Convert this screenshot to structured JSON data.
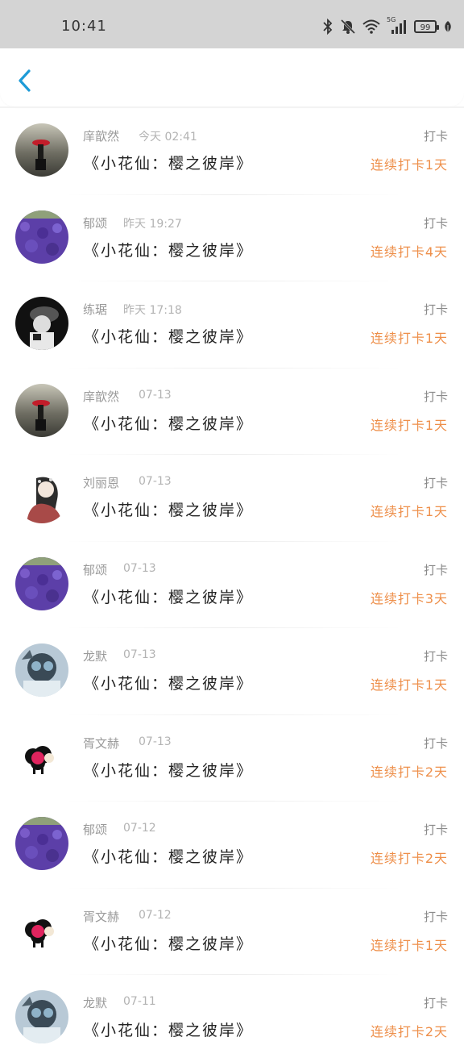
{
  "status_bar": {
    "time": "10:41",
    "battery": "99",
    "network": "5G",
    "icons": [
      "bluetooth-icon",
      "mute-bell-icon",
      "wifi-icon",
      "signal-icon",
      "battery-icon",
      "leaf-icon"
    ]
  },
  "header": {
    "back_icon": "chevron-left-icon",
    "accent_color": "#1e9bd7"
  },
  "colors": {
    "streak": "#ee8f4a",
    "name": "#9a9a9a"
  },
  "checkins": [
    {
      "name": "庠歆然",
      "time": "今天 02:41",
      "title": "《小花仙：樱之彼岸》",
      "action": "打卡",
      "streak": "连续打卡1天",
      "avatar": "red-umbrella-avatar"
    },
    {
      "name": "郁颂",
      "time": "昨天 19:27",
      "title": "《小花仙：樱之彼岸》",
      "action": "打卡",
      "streak": "连续打卡4天",
      "avatar": "lavender-field-avatar"
    },
    {
      "name": "练琚",
      "time": "昨天 17:18",
      "title": "《小花仙：樱之彼岸》",
      "action": "打卡",
      "streak": "连续打卡1天",
      "avatar": "bw-portrait-avatar"
    },
    {
      "name": "庠歆然",
      "time": "07-13",
      "title": "《小花仙：樱之彼岸》",
      "action": "打卡",
      "streak": "连续打卡1天",
      "avatar": "red-umbrella-avatar"
    },
    {
      "name": "刘丽恩",
      "time": "07-13",
      "title": "《小花仙：樱之彼岸》",
      "action": "打卡",
      "streak": "连续打卡1天",
      "avatar": "girl-illustration-avatar"
    },
    {
      "name": "郁颂",
      "time": "07-13",
      "title": "《小花仙：樱之彼岸》",
      "action": "打卡",
      "streak": "连续打卡3天",
      "avatar": "lavender-field-avatar"
    },
    {
      "name": "龙默",
      "time": "07-13",
      "title": "《小花仙：樱之彼岸》",
      "action": "打卡",
      "streak": "连续打卡1天",
      "avatar": "sci-fi-avatar"
    },
    {
      "name": "胥文赫",
      "time": "07-13",
      "title": "《小花仙：樱之彼岸》",
      "action": "打卡",
      "streak": "连续打卡2天",
      "avatar": "cartoon-sheep-avatar"
    },
    {
      "name": "郁颂",
      "time": "07-12",
      "title": "《小花仙：樱之彼岸》",
      "action": "打卡",
      "streak": "连续打卡2天",
      "avatar": "lavender-field-avatar"
    },
    {
      "name": "胥文赫",
      "time": "07-12",
      "title": "《小花仙：樱之彼岸》",
      "action": "打卡",
      "streak": "连续打卡1天",
      "avatar": "cartoon-sheep-avatar"
    },
    {
      "name": "龙默",
      "time": "07-11",
      "title": "《小花仙：樱之彼岸》",
      "action": "打卡",
      "streak": "连续打卡2天",
      "avatar": "sci-fi-avatar"
    }
  ]
}
